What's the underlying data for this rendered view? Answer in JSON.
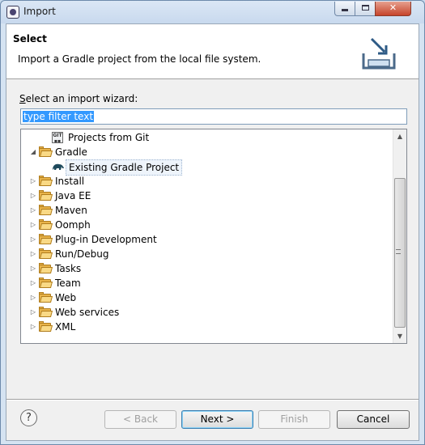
{
  "window": {
    "title": "Import"
  },
  "header": {
    "title": "Select",
    "description": "Import a Gradle project from the local file system."
  },
  "wizard_label": {
    "prefix": "S",
    "rest": "elect an import wizard:"
  },
  "filter": {
    "value": "type filter text"
  },
  "tree": {
    "items": [
      {
        "label": "Projects from Git",
        "icon": "git-icon"
      },
      {
        "label": "Gradle",
        "icon": "folder-open-icon",
        "expanded": true
      },
      {
        "label": "Existing Gradle Project",
        "icon": "gradle-elephant-icon",
        "selected": true
      },
      {
        "label": "Install",
        "icon": "folder-icon"
      },
      {
        "label": "Java EE",
        "icon": "folder-icon"
      },
      {
        "label": "Maven",
        "icon": "folder-icon"
      },
      {
        "label": "Oomph",
        "icon": "folder-icon"
      },
      {
        "label": "Plug-in Development",
        "icon": "folder-icon"
      },
      {
        "label": "Run/Debug",
        "icon": "folder-icon"
      },
      {
        "label": "Tasks",
        "icon": "folder-icon"
      },
      {
        "label": "Team",
        "icon": "folder-icon"
      },
      {
        "label": "Web",
        "icon": "folder-icon"
      },
      {
        "label": "Web services",
        "icon": "folder-icon"
      },
      {
        "label": "XML",
        "icon": "folder-icon"
      }
    ]
  },
  "buttons": {
    "help": "?",
    "back": "< Back",
    "next": "Next >",
    "finish": "Finish",
    "cancel": "Cancel"
  }
}
